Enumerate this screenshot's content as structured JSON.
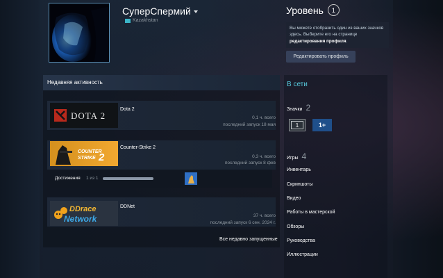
{
  "profile": {
    "username": "СуперСпермий",
    "country": "Kazakhstan"
  },
  "level": {
    "label": "Уровень",
    "value": "1",
    "info_text": "Вы можете отобразить один из ваших значков здесь. Выберите его на странице ",
    "info_link": "редактирования профиля",
    "info_end": ".",
    "edit_button": "Редактировать профиль"
  },
  "activity": {
    "title": "Недавняя активность",
    "games": [
      {
        "name": "Dota 2",
        "hours": "0,1 ч. всего",
        "last_played": "последний запуск 18 мая",
        "capsule": "DOTA 2"
      },
      {
        "name": "Counter-Strike 2",
        "hours": "0,3 ч. всего",
        "last_played": "последний запуск 8 фев",
        "capsule": "COUNTER STRIKE 2"
      },
      {
        "name": "DDNet",
        "hours": "37 ч. всего",
        "last_played": "последний запуск 6 сен. 2024 г.",
        "capsule": "DDrace Network"
      }
    ],
    "achievements": {
      "label": "Достижения",
      "count": "1 из 1",
      "progress": 1.0
    },
    "recent_link": "Все недавно запущенные"
  },
  "sidebar": {
    "status": "В сети",
    "badges_label": "Значки",
    "badges_count": "2",
    "badge_items": [
      "1",
      "1+"
    ],
    "games_label": "Игры",
    "games_count": "4",
    "links": [
      "Инвентарь",
      "Скриншоты",
      "Видео",
      "Работы в мастерской",
      "Обзоры",
      "Руководства",
      "Иллюстрации"
    ]
  },
  "colors": {
    "accent_online": "#57cbde",
    "background": "#1b2838",
    "badge_blue": "#1f4f8a"
  }
}
